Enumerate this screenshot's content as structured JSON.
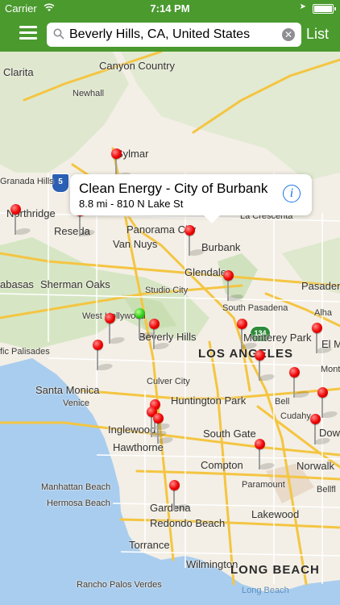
{
  "status_bar": {
    "carrier": "Carrier",
    "time": "7:14 PM",
    "battery_level": 1.0
  },
  "nav": {
    "search_value": "Beverly Hills, CA, United States",
    "list_label": "List"
  },
  "callout": {
    "title": "Clean Energy - City of Burbank",
    "subtitle": "8.8 mi - 810 N Lake St",
    "info_icon": "i"
  },
  "shields": {
    "i5": "5",
    "ca134": "134"
  },
  "map_labels": {
    "santa_clarita": "Clarita",
    "canyon_country": "Canyon Country",
    "newhall": "Newhall",
    "sylmar": "Sylmar",
    "granada_hills": "Granada Hills",
    "northridge": "Northridge",
    "reseda": "Reseda",
    "panorama_city": "Panorama City",
    "van_nuys": "Van Nuys",
    "la_crescenta": "La Crescenta",
    "burbank": "Burbank",
    "sherman_oaks": "Sherman Oaks",
    "calabasas": "abasas",
    "glendale": "Glendale",
    "pasadena": "Pasadena",
    "studio_city": "Studio City",
    "south_pasadena": "South Pasadena",
    "west_hollywood": "West Hollywood",
    "beverly_hills": "Beverly Hills",
    "monterey_park": "Monterey Park",
    "el_monte": "El M",
    "alhambra": "Alha",
    "los_angeles": "LOS ANGELES",
    "pacific_palisades": "fic Palisades",
    "culver_city": "Culver City",
    "santa_monica": "Santa Monica",
    "venice": "Venice",
    "huntington_park": "Huntington Park",
    "bell": "Bell",
    "cudahy": "Cudahy",
    "downey": "Down",
    "mont": "Mont",
    "inglewood": "Inglewood",
    "south_gate": "South Gate",
    "hawthorne": "Hawthorne",
    "compton": "Compton",
    "norwalk": "Norwalk",
    "manhattan_beach": "Manhattan Beach",
    "paramount": "Paramount",
    "bellflower": "Bellfl",
    "hermosa_beach": "Hermosa Beach",
    "gardena": "Gardena",
    "redondo_beach": "Redondo Beach",
    "lakewood": "Lakewood",
    "torrance": "Torrance",
    "wilmington": "Wilmington",
    "long_beach": "LONG BEACH",
    "rancho_palos_verdes": "Rancho Palos Verdes",
    "long_beach_bay": "Long Beach"
  },
  "colors": {
    "brand_green": "#4a9a2e",
    "pin_red": "#e00000",
    "selected_pin_green": "#2ecc1a",
    "info_blue": "#1a73e8"
  }
}
